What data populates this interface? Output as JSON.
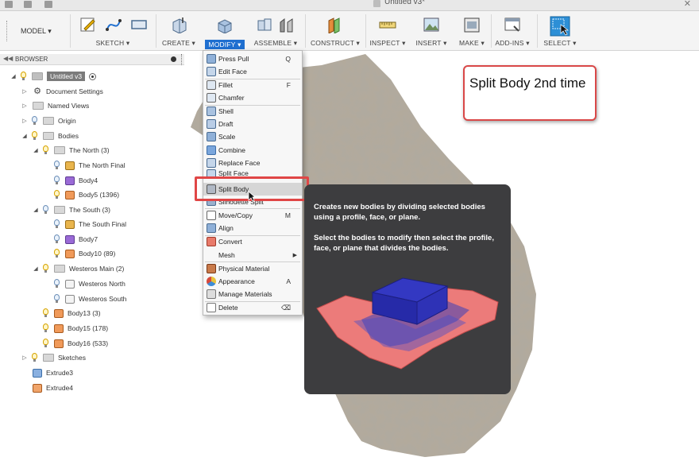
{
  "window": {
    "title": "Untitled v3*"
  },
  "toolbar": {
    "workspace": "MODEL",
    "groups": [
      {
        "label": "SKETCH ▾"
      },
      {
        "label": "CREATE ▾"
      },
      {
        "label": "MODIFY ▾"
      },
      {
        "label": "ASSEMBLE ▾"
      },
      {
        "label": "CONSTRUCT ▾"
      },
      {
        "label": "INSPECT ▾"
      },
      {
        "label": "INSERT ▾"
      },
      {
        "label": "MAKE ▾"
      },
      {
        "label": "ADD-INS ▾"
      },
      {
        "label": "SELECT ▾"
      }
    ]
  },
  "browser": {
    "title": "BROWSER",
    "items": [
      {
        "label": "Untitled v3"
      },
      {
        "label": "Document Settings"
      },
      {
        "label": "Named Views"
      },
      {
        "label": "Origin"
      },
      {
        "label": "Bodies"
      },
      {
        "label": "The North (3)"
      },
      {
        "label": "The North Final"
      },
      {
        "label": "Body4"
      },
      {
        "label": "Body5 (1396)"
      },
      {
        "label": "The South (3)"
      },
      {
        "label": "The South Final"
      },
      {
        "label": "Body7"
      },
      {
        "label": "Body10 (89)"
      },
      {
        "label": "Westeros Main (2)"
      },
      {
        "label": "Westeros North"
      },
      {
        "label": "Westeros South"
      },
      {
        "label": "Body13 (3)"
      },
      {
        "label": "Body15 (178)"
      },
      {
        "label": "Body16 (533)"
      },
      {
        "label": "Sketches"
      },
      {
        "label": "Extrude3"
      },
      {
        "label": "Extrude4"
      }
    ]
  },
  "menu": {
    "items": [
      {
        "label": "Press Pull",
        "key": "Q"
      },
      {
        "label": "Edit Face",
        "key": ""
      },
      {
        "label": "Fillet",
        "key": "F"
      },
      {
        "label": "Chamfer",
        "key": ""
      },
      {
        "label": "Shell",
        "key": ""
      },
      {
        "label": "Draft",
        "key": ""
      },
      {
        "label": "Scale",
        "key": ""
      },
      {
        "label": "Combine",
        "key": ""
      },
      {
        "label": "Replace Face",
        "key": ""
      },
      {
        "label": "Split Face",
        "key": ""
      },
      {
        "label": "Split Body",
        "key": ""
      },
      {
        "label": "Silhouette Split",
        "key": ""
      },
      {
        "label": "Move/Copy",
        "key": "M"
      },
      {
        "label": "Align",
        "key": ""
      },
      {
        "label": "Convert",
        "key": ""
      },
      {
        "label": "Mesh",
        "key": "▶"
      },
      {
        "label": "Physical Material",
        "key": ""
      },
      {
        "label": "Appearance",
        "key": "A"
      },
      {
        "label": "Manage Materials",
        "key": ""
      },
      {
        "label": "Delete",
        "key": "⌫"
      }
    ]
  },
  "tooltip": {
    "line1": "Creates new bodies by dividing selected bodies using a profile, face, or plane.",
    "line2": "Select the bodies to modify then select the profile, face, or plane that divides the bodies."
  },
  "note": {
    "text": "Split Body 2nd time"
  },
  "colors": {
    "accent": "#1f6fd0",
    "highlight": "#e04646",
    "tooltip_bg": "#3d3d3f"
  }
}
